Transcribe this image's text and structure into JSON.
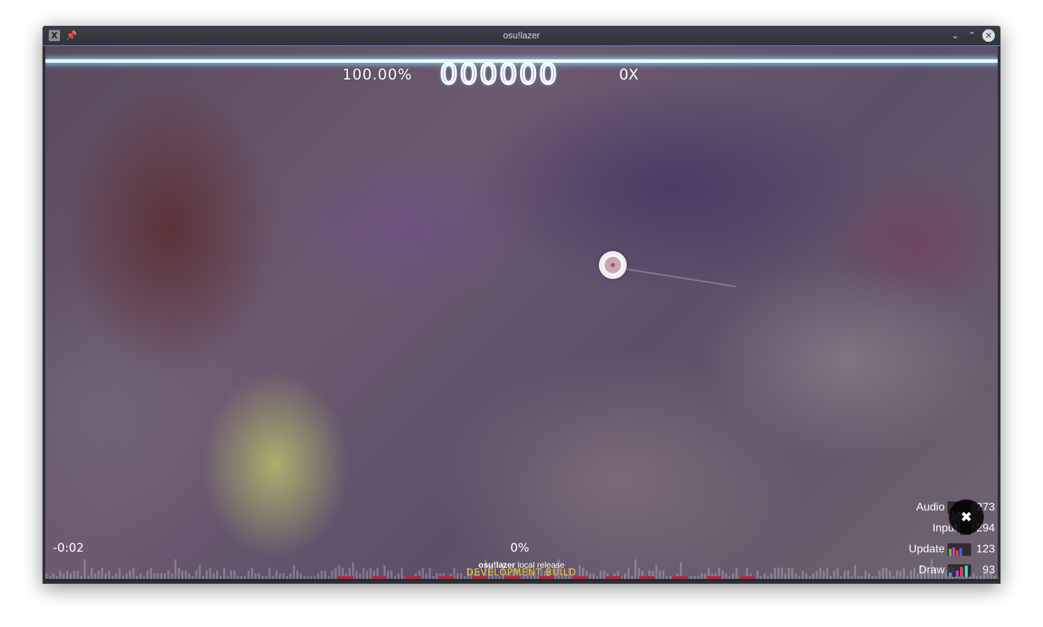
{
  "window": {
    "title": "osu!lazer",
    "app_icon": "X",
    "pin_icon": "📌",
    "minimize_icon": "⌄",
    "maximize_icon": "⌃",
    "close_icon": "✕"
  },
  "hud": {
    "accuracy": "100.00%",
    "score": "000000",
    "combo": "0X",
    "time_remaining": "-0:02",
    "progress_percent": "0%",
    "health_fraction": 1.0
  },
  "footer": {
    "version_name": "osu!lazer",
    "version_channel": "local release",
    "build_label": "DEVELOPMENT BUILD"
  },
  "performance": {
    "rows": [
      {
        "label": "Audio",
        "value": "273"
      },
      {
        "label": "Input",
        "value": "294"
      },
      {
        "label": "Update",
        "value": "123"
      },
      {
        "label": "Draw",
        "value": "93"
      }
    ],
    "exit_icon": "✖"
  },
  "colors": {
    "accent_cyan": "#8cdcff",
    "build_yellow": "#ffcc22",
    "stripe_red": "#c2223a"
  }
}
